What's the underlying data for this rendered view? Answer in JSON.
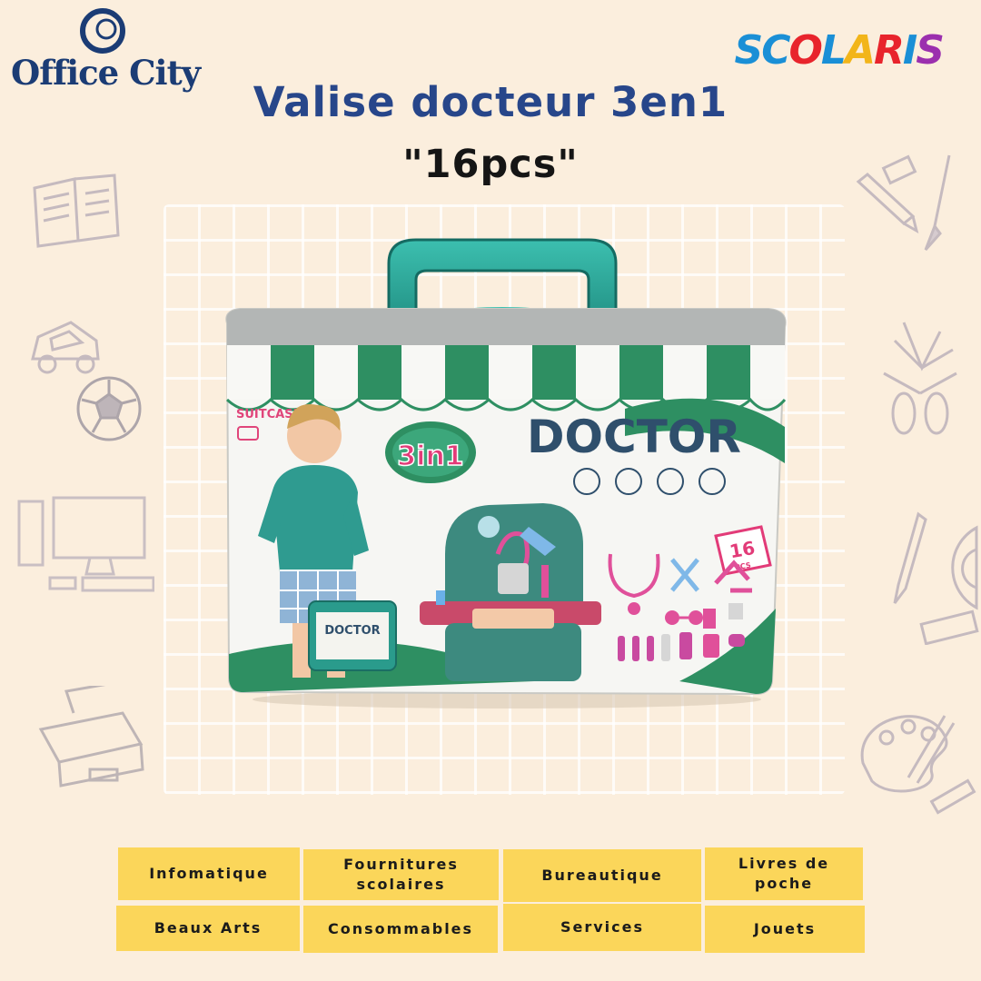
{
  "brand_left": {
    "name": "Office City"
  },
  "brand_right": {
    "name": "SCOLARIS"
  },
  "product": {
    "title": "Valise docteur 3en1",
    "subtitle": "\"16pcs\"",
    "box": {
      "suitcase_label": "SUITCASE",
      "main_label": "DOCTOR",
      "badge": "3in1",
      "pieces_count": "16",
      "pieces_unit": "PCS",
      "mini_case_label": "DOCTOR"
    }
  },
  "colors": {
    "background": "#fbeedd",
    "title_blue": "#27468a",
    "nav_yellow": "#fbd65a",
    "box_green": "#2e8f62",
    "handle_teal": "#26a89a"
  },
  "nav": {
    "items": [
      {
        "label": "Infomatique"
      },
      {
        "label": "Fournitures scolaires"
      },
      {
        "label": "Bureautique"
      },
      {
        "label": "Livres de poche"
      },
      {
        "label": "Beaux Arts"
      },
      {
        "label": "Consommables"
      },
      {
        "label": "Services"
      },
      {
        "label": "Jouets"
      }
    ]
  },
  "decorations": [
    "book-icon",
    "car-icon",
    "football-icon",
    "computer-icon",
    "printer-icon",
    "pencil-icon",
    "brush-icon",
    "scissors-icon",
    "pen-icon",
    "protractor-icon",
    "eraser-icon",
    "palette-icon"
  ]
}
